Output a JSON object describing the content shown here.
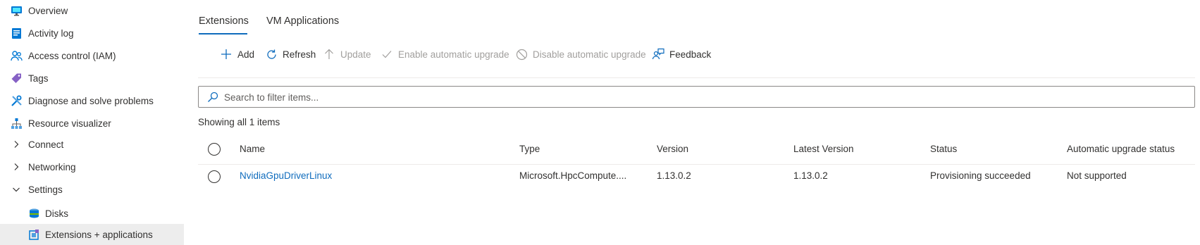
{
  "sidebar": {
    "items": [
      {
        "label": "Overview",
        "icon": "monitor-icon"
      },
      {
        "label": "Activity log",
        "icon": "log-icon"
      },
      {
        "label": "Access control (IAM)",
        "icon": "people-icon"
      },
      {
        "label": "Tags",
        "icon": "tag-icon"
      },
      {
        "label": "Diagnose and solve problems",
        "icon": "wrench-icon"
      },
      {
        "label": "Resource visualizer",
        "icon": "hierarchy-icon"
      },
      {
        "label": "Connect",
        "icon": "chevron-right-icon"
      },
      {
        "label": "Networking",
        "icon": "chevron-right-icon"
      },
      {
        "label": "Settings",
        "icon": "chevron-down-icon"
      },
      {
        "label": "Disks",
        "icon": "disk-icon"
      },
      {
        "label": "Extensions + applications",
        "icon": "extension-icon"
      }
    ]
  },
  "tabs": [
    {
      "label": "Extensions",
      "selected": true
    },
    {
      "label": "VM Applications",
      "selected": false
    }
  ],
  "toolbar": {
    "add": "Add",
    "refresh": "Refresh",
    "update": "Update",
    "enable_upgrade": "Enable automatic upgrade",
    "disable_upgrade": "Disable automatic upgrade",
    "feedback": "Feedback"
  },
  "search": {
    "placeholder": "Search to filter items..."
  },
  "count_text": "Showing all 1 items",
  "table": {
    "columns": [
      "Name",
      "Type",
      "Version",
      "Latest Version",
      "Status",
      "Automatic upgrade status"
    ],
    "rows": [
      {
        "name": "NvidiaGpuDriverLinux",
        "type": "Microsoft.HpcCompute....",
        "version": "1.13.0.2",
        "latest_version": "1.13.0.2",
        "status": "Provisioning succeeded",
        "auto_upgrade": "Not supported"
      }
    ]
  },
  "colors": {
    "accent": "#0f6cbd",
    "disabled": "#a19f9d",
    "selected_bg": "#ededed"
  }
}
